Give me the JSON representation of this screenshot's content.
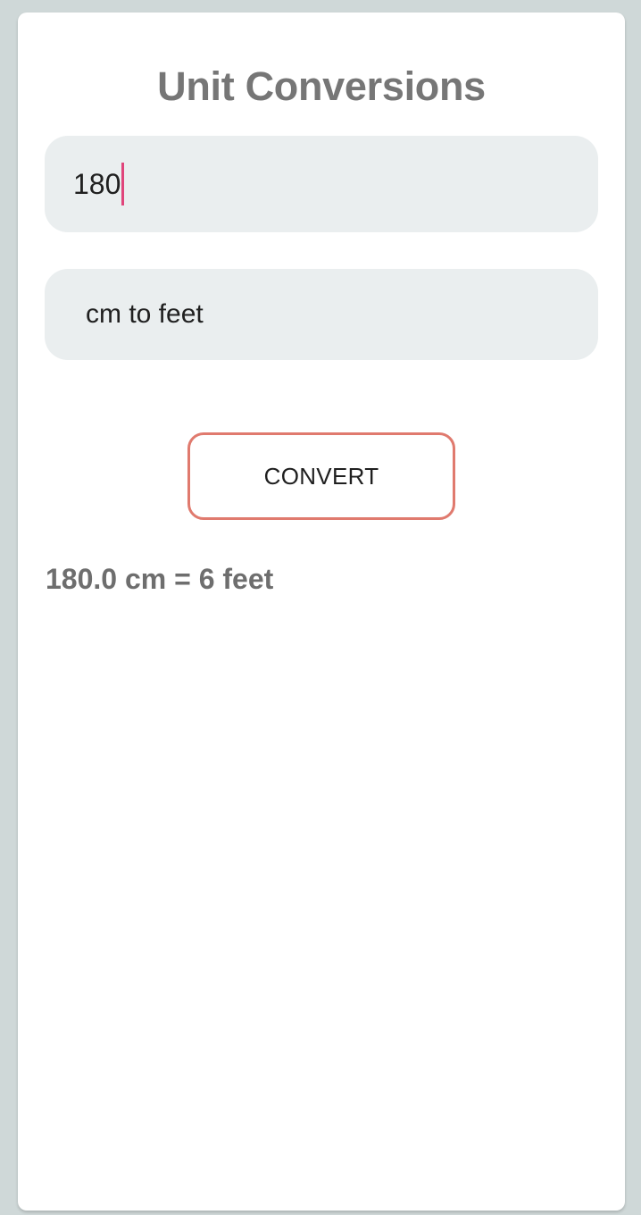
{
  "app": {
    "title": "Unit Conversions"
  },
  "form": {
    "value_input": {
      "value": "180"
    },
    "unit_select": {
      "selected": "cm to feet"
    },
    "convert_button": {
      "label": "CONVERT"
    }
  },
  "result": {
    "text": "180.0 cm = 6 feet"
  },
  "colors": {
    "background": "#cfd8d8",
    "card": "#ffffff",
    "field_bg": "#eaeeef",
    "button_border": "#e07a6e",
    "caret": "#e0457b",
    "title_text": "#767676"
  }
}
